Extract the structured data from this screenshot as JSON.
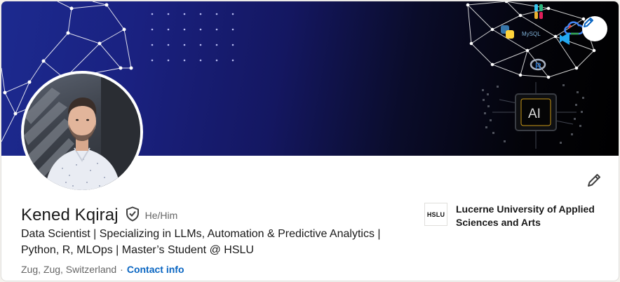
{
  "profile": {
    "name": "Kened Kqiraj",
    "pronouns": "He/Him",
    "headline": "Data Scientist | Specializing in LLMs, Automation & Predictive Analytics | Python, R, MLOps | Master’s Student @ HSLU",
    "location": "Zug, Zug, Switzerland",
    "separator": "·",
    "contact_label": "Contact info"
  },
  "education": {
    "logo_text": "HSLU",
    "name": "Lucerne University of Applied Sciences and Arts"
  },
  "banner": {
    "ai_chip_text": "AI",
    "mysql_text": "MySQL",
    "r_text": "R"
  },
  "icons": {
    "edit_banner": "pencil-icon",
    "edit_intro": "pencil-icon",
    "verified": "shield-check-icon"
  },
  "colors": {
    "link": "#0a66c2",
    "text_primary": "#191919",
    "text_secondary": "#666666",
    "banner_blue": "#1c2a8f"
  }
}
